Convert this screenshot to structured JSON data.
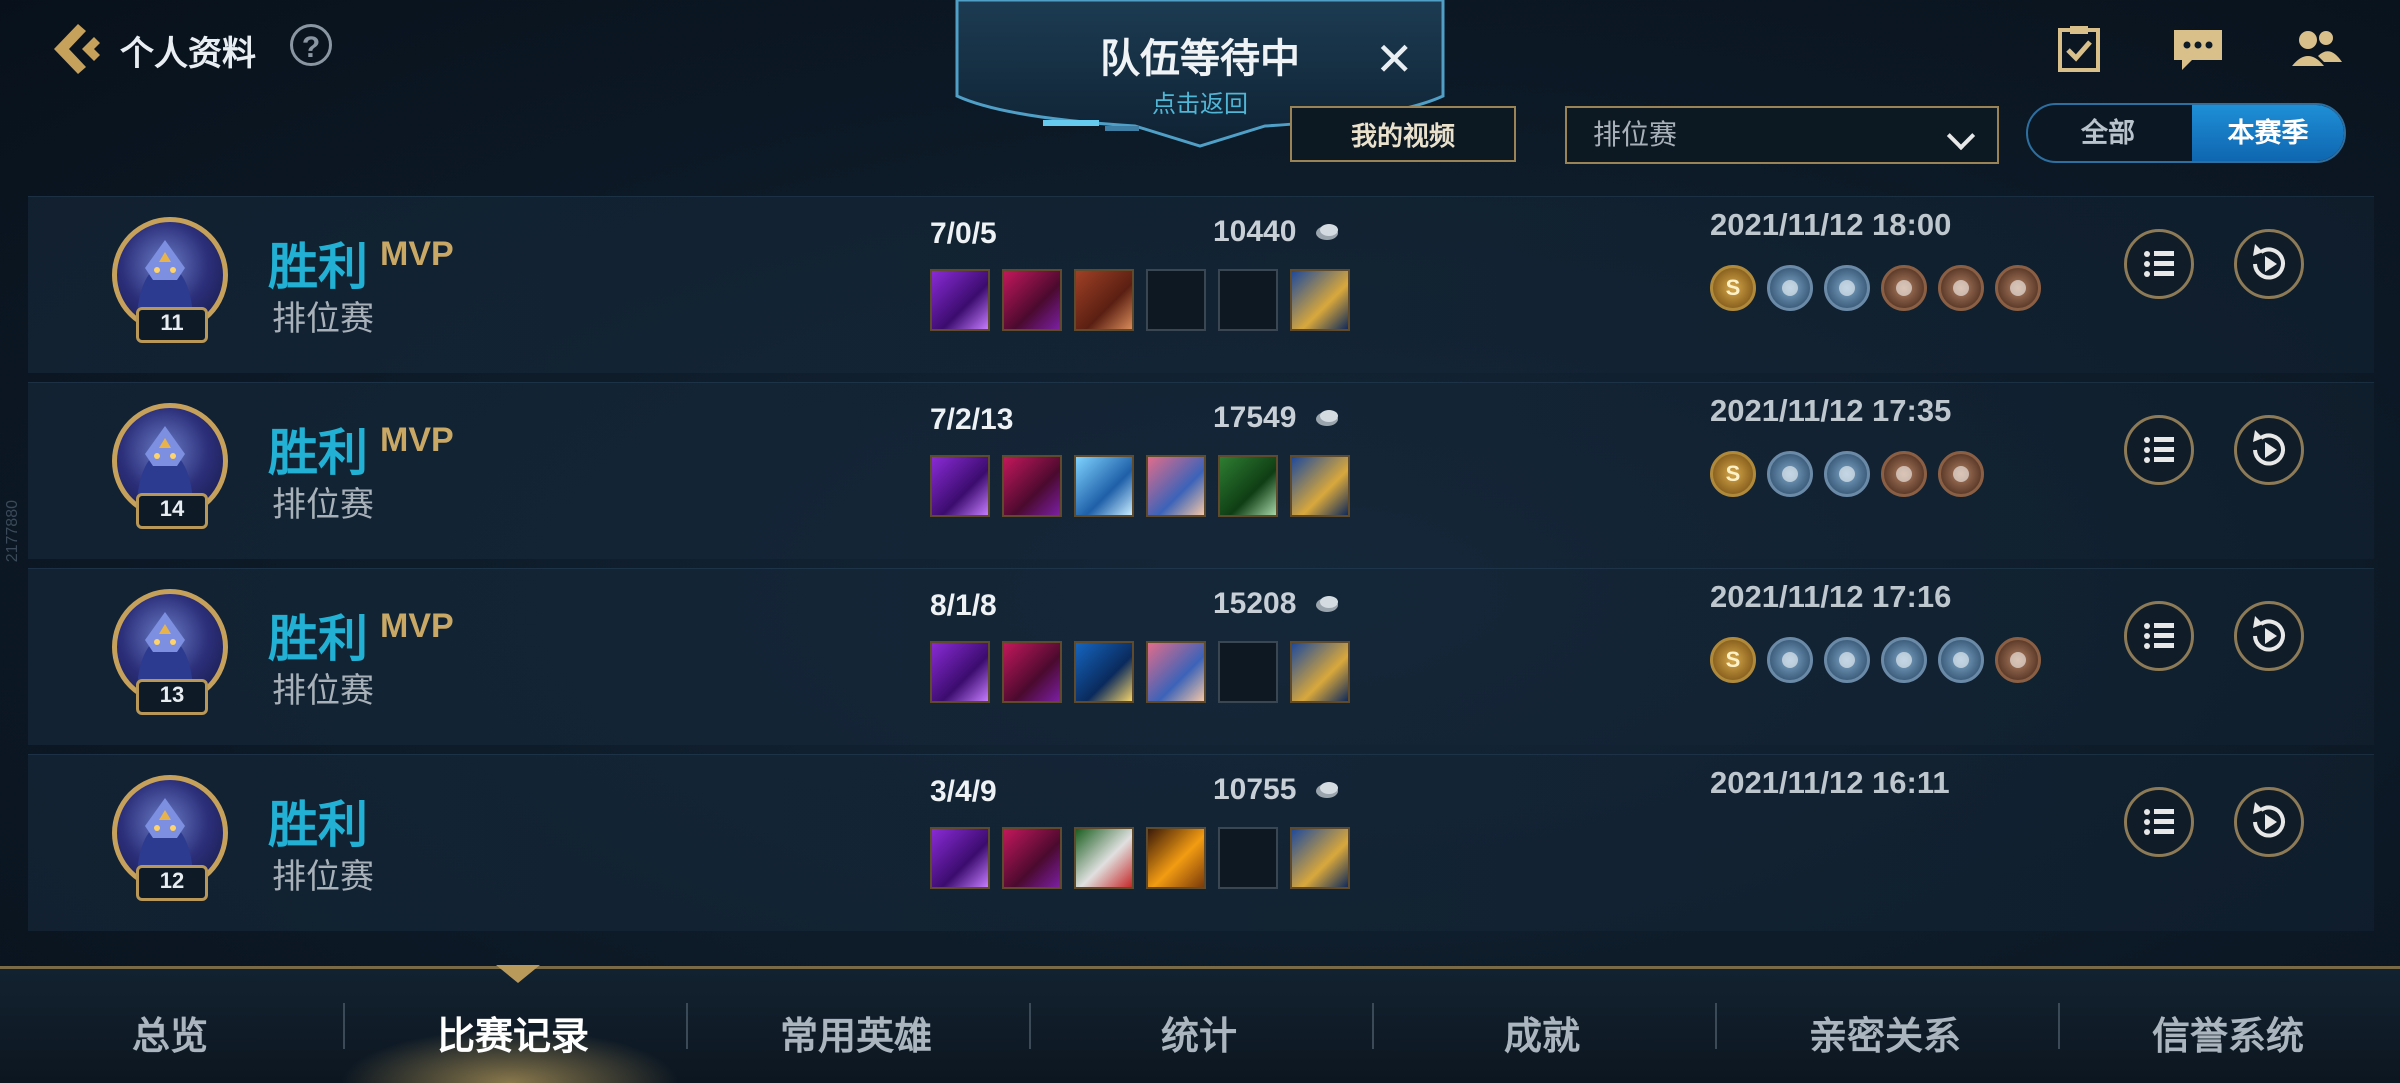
{
  "header": {
    "back_label": "",
    "title": "个人资料",
    "help_glyph": "?",
    "icons": [
      "tasks-icon",
      "chat-icon",
      "friends-icon"
    ]
  },
  "banner": {
    "title": "队伍等待中",
    "subtitle": "点击返回",
    "close_glyph": "✕"
  },
  "filters": {
    "my_video": "我的视频",
    "mode": "排位赛",
    "toggle": {
      "all": "全部",
      "season": "本赛季",
      "selected": "本赛季"
    }
  },
  "side_id": "2177880",
  "matches": [
    {
      "result": "胜利",
      "mvp": "MVP",
      "mode": "排位赛",
      "level": "11",
      "kda": "7/0/5",
      "gold": "10440",
      "datetime": "2021/11/12 18:00",
      "items": [
        "purple-hammer",
        "crimson-mask",
        "red-book",
        "empty",
        "empty",
        "golden-hourglass"
      ],
      "medals": [
        "gold-s",
        "blue",
        "blue",
        "bronze",
        "bronze",
        "bronze"
      ]
    },
    {
      "result": "胜利",
      "mvp": "MVP",
      "mode": "排位赛",
      "level": "14",
      "kda": "7/2/13",
      "gold": "17549",
      "datetime": "2021/11/12 17:35",
      "items": [
        "purple-hammer",
        "crimson-mask",
        "ice-creature",
        "fox-mask",
        "green-helm",
        "golden-hourglass"
      ],
      "medals": [
        "gold-s",
        "blue",
        "blue",
        "bronze",
        "bronze"
      ]
    },
    {
      "result": "胜利",
      "mvp": "MVP",
      "mode": "排位赛",
      "level": "13",
      "kda": "8/1/8",
      "gold": "15208",
      "datetime": "2021/11/12 17:16",
      "items": [
        "purple-hammer",
        "crimson-mask",
        "blue-spear",
        "fox-mask",
        "empty",
        "golden-hourglass"
      ],
      "medals": [
        "gold-s",
        "blue",
        "blue",
        "blue",
        "blue",
        "bronze"
      ]
    },
    {
      "result": "胜利",
      "mvp": "",
      "mode": "排位赛",
      "level": "12",
      "kda": "3/4/9",
      "gold": "10755",
      "datetime": "2021/11/12 16:11",
      "items": [
        "purple-hammer",
        "crimson-mask",
        "green-mask",
        "orange-staff",
        "empty",
        "golden-hourglass"
      ],
      "medals": []
    }
  ],
  "nav": {
    "items": [
      "总览",
      "比赛记录",
      "常用英雄",
      "统计",
      "成就",
      "亲密关系",
      "信誉系统"
    ],
    "active_index": 1
  },
  "colors": {
    "victory": "#22b1d4",
    "mvp": "#c9a866",
    "gold_border": "#c6a15c",
    "active_toggle": "#1e8fd6"
  }
}
